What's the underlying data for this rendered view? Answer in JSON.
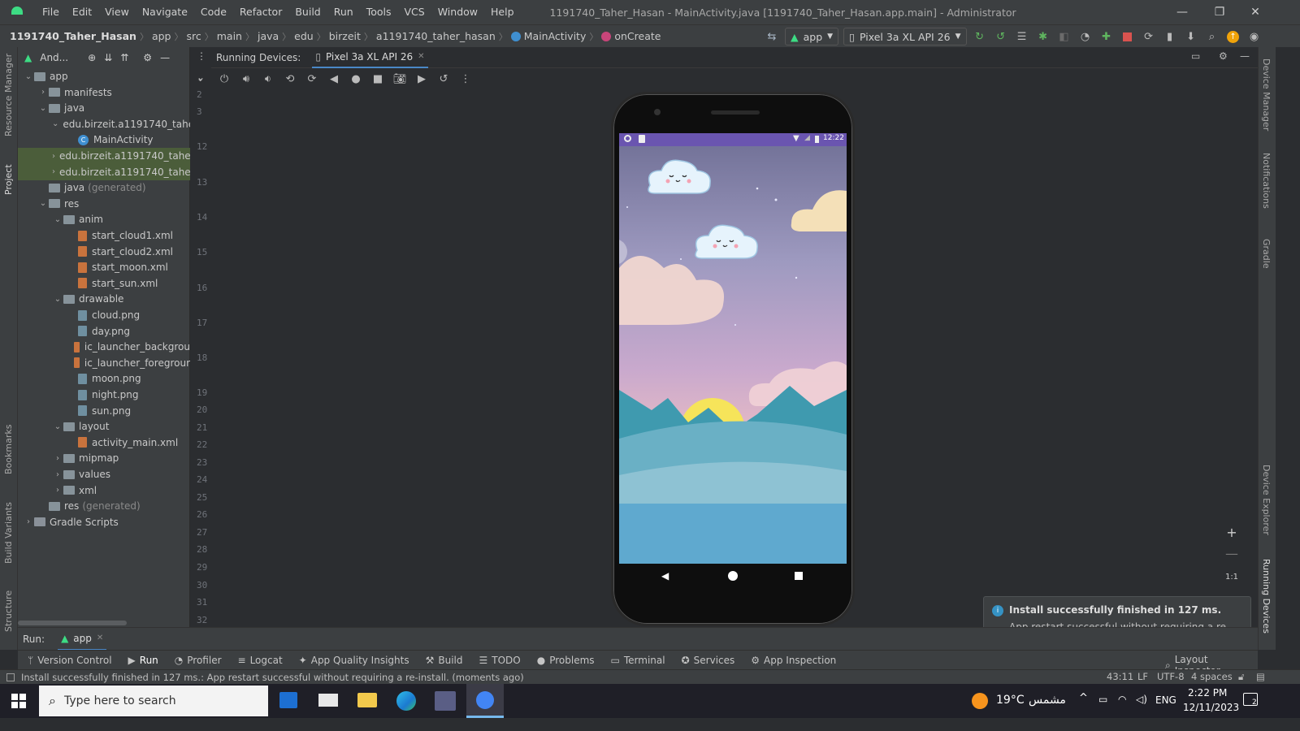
{
  "titlebar": {
    "menu": [
      "File",
      "Edit",
      "View",
      "Navigate",
      "Code",
      "Refactor",
      "Build",
      "Run",
      "Tools",
      "VCS",
      "Window",
      "Help"
    ],
    "window_title": "1191740_Taher_Hasan - MainActivity.java [1191740_Taher_Hasan.app.main] - Administrator"
  },
  "navbar": {
    "crumbs": [
      "1191740_Taher_Hasan",
      "app",
      "src",
      "main",
      "java",
      "edu",
      "birzeit",
      "a1191740_taher_hasan",
      "MainActivity",
      "onCreate"
    ],
    "run_config": "app",
    "device": "Pixel 3a XL API 26"
  },
  "leftstripe": {
    "resource_manager": "Resource Manager",
    "project": "Project",
    "bookmarks": "Bookmarks",
    "build_variants": "Build Variants",
    "structure": "Structure"
  },
  "rightstripe": {
    "device_manager": "Device Manager",
    "notifications": "Notifications",
    "gradle": "Gradle",
    "device_explorer": "Device Explorer",
    "running_devices": "Running Devices"
  },
  "project": {
    "title": "And...",
    "tree": [
      {
        "label": "app",
        "depth": 0,
        "kind": "folder",
        "chev": "v"
      },
      {
        "label": "manifests",
        "depth": 1,
        "kind": "folder",
        "chev": ">"
      },
      {
        "label": "java",
        "depth": 1,
        "kind": "folder",
        "chev": "v"
      },
      {
        "label": "edu.birzeit.a1191740_tahe",
        "depth": 2,
        "kind": "pkg",
        "chev": "v"
      },
      {
        "label": "MainActivity",
        "depth": 3,
        "kind": "class",
        "chev": ""
      },
      {
        "label": "edu.birzeit.a1191740_tahe",
        "depth": 2,
        "kind": "pkg",
        "chev": ">",
        "sel": true
      },
      {
        "label": "edu.birzeit.a1191740_tahe",
        "depth": 2,
        "kind": "pkg",
        "chev": ">",
        "sel": true
      },
      {
        "label": "java",
        "suffix": "(generated)",
        "depth": 1,
        "kind": "gen",
        "chev": ""
      },
      {
        "label": "res",
        "depth": 1,
        "kind": "folder",
        "chev": "v"
      },
      {
        "label": "anim",
        "depth": 2,
        "kind": "folder",
        "chev": "v"
      },
      {
        "label": "start_cloud1.xml",
        "depth": 3,
        "kind": "xml",
        "chev": ""
      },
      {
        "label": "start_cloud2.xml",
        "depth": 3,
        "kind": "xml",
        "chev": ""
      },
      {
        "label": "start_moon.xml",
        "depth": 3,
        "kind": "xml",
        "chev": ""
      },
      {
        "label": "start_sun.xml",
        "depth": 3,
        "kind": "xml",
        "chev": ""
      },
      {
        "label": "drawable",
        "depth": 2,
        "kind": "folder",
        "chev": "v"
      },
      {
        "label": "cloud.png",
        "depth": 3,
        "kind": "png",
        "chev": ""
      },
      {
        "label": "day.png",
        "depth": 3,
        "kind": "png",
        "chev": ""
      },
      {
        "label": "ic_launcher_backgrou",
        "depth": 3,
        "kind": "xml",
        "chev": ""
      },
      {
        "label": "ic_launcher_foregrour",
        "depth": 3,
        "kind": "xml",
        "chev": ""
      },
      {
        "label": "moon.png",
        "depth": 3,
        "kind": "png",
        "chev": ""
      },
      {
        "label": "night.png",
        "depth": 3,
        "kind": "png",
        "chev": ""
      },
      {
        "label": "sun.png",
        "depth": 3,
        "kind": "png",
        "chev": ""
      },
      {
        "label": "layout",
        "depth": 2,
        "kind": "folder",
        "chev": "v"
      },
      {
        "label": "activity_main.xml",
        "depth": 3,
        "kind": "xml",
        "chev": ""
      },
      {
        "label": "mipmap",
        "depth": 2,
        "kind": "folder",
        "chev": ">"
      },
      {
        "label": "values",
        "depth": 2,
        "kind": "folder",
        "chev": ">"
      },
      {
        "label": "xml",
        "depth": 2,
        "kind": "folder",
        "chev": ">"
      },
      {
        "label": "res",
        "suffix": "(generated)",
        "depth": 1,
        "kind": "gen",
        "chev": ""
      },
      {
        "label": "Gradle Scripts",
        "depth": 0,
        "kind": "gradle",
        "chev": ">"
      }
    ]
  },
  "gutter": {
    "lines": [
      "2",
      "3",
      "12",
      "13",
      "14",
      "15",
      "16",
      "17",
      "18",
      "19",
      "20",
      "21",
      "22",
      "23",
      "24",
      "25",
      "26",
      "27",
      "28",
      "29",
      "30",
      "31",
      "32"
    ]
  },
  "running_devices": {
    "label": "Running Devices:",
    "tab": "Pixel 3a XL API 26",
    "phone_time": "12:22",
    "zoom_reset": "1:1"
  },
  "run": {
    "label": "Run:",
    "tab": "app"
  },
  "toolwindows": [
    "Version Control",
    "Run",
    "Profiler",
    "Logcat",
    "App Quality Insights",
    "Build",
    "TODO",
    "Problems",
    "Terminal",
    "Services",
    "App Inspection"
  ],
  "layout_inspector": "Layout Inspector",
  "status": {
    "message": "Install successfully finished in 127 ms.: App restart successful without requiring a re-install. (moments ago)",
    "position": "43:11",
    "line_sep": "LF",
    "encoding": "UTF-8",
    "indent": "4 spaces"
  },
  "notification": {
    "title": "Install successfully finished in 127 ms.",
    "body": "App restart successful without requiring a re-install."
  },
  "taskbar": {
    "search_placeholder": "Type here to search",
    "weather_temp": "19°C",
    "weather_text": "مشمس",
    "lang": "ENG",
    "time": "2:22 PM",
    "date": "12/11/2023",
    "notif_count": "2"
  },
  "colors": {
    "accent_green": "#3ddc84",
    "sel_row": "#4b5d3a",
    "status_purple": "#6a55b0",
    "stop_red": "#d9534f"
  }
}
